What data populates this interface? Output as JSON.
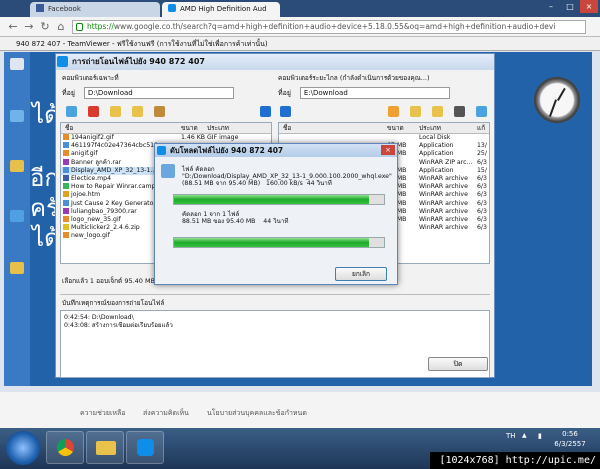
{
  "browser": {
    "tabs": [
      {
        "label": "Facebook"
      },
      {
        "label": "AMD High Definition Aud"
      }
    ],
    "url_scheme": "https://",
    "url_rest": "www.google.co.th/search?q=amd+high+definition+audio+device+5.18.0.55&oq=amd+high+definition+audio+devi"
  },
  "teamviewer": {
    "title": "940 872 407 - TeamViewer - ฟรีใช้งานฟรี (การใช้งานที่ไม่ใช่เพื่อการค้าเท่านั้น)"
  },
  "remote_desktop": {
    "left_chars": [
      "ได้",
      "อีก",
      "ครั",
      "ได้"
    ]
  },
  "file_transfer": {
    "title": "การถ่ายโอนไฟล์ไปยัง 940 872 407",
    "local_heading": "คอมพิวเตอร์เฉพาะที่",
    "remote_heading": "คอมพิวเตอร์ระยะไกล (กำลังดำเนินการด้วยของคุณ...)",
    "loc_label": "ที่อยู่",
    "local_path": "D:\\Download",
    "remote_path": "E:\\Download",
    "columns": {
      "name": "ชื่อ",
      "size": "ขนาด",
      "type": "ประเภท",
      "modified": "แก้"
    },
    "local_files": [
      {
        "name": "194anigif2.gif",
        "size": "1.46 KB",
        "type": "GIF image",
        "color": "#e88b2b"
      },
      {
        "name": "461197f4c02e47364cbc519...",
        "size": "",
        "type": "",
        "color": "#4c8fd6"
      },
      {
        "name": "anigif.gif",
        "size": "",
        "type": "",
        "color": "#e88b2b"
      },
      {
        "name": "Banner ลูกค้า.rar",
        "size": "",
        "type": "",
        "color": "#9b3ab5"
      },
      {
        "name": "Display_AMD_XP_32_13-1...",
        "size": "",
        "type": "",
        "color": "#4c8fd6"
      },
      {
        "name": "Electice.mp4",
        "size": "",
        "type": "",
        "color": "#3a5fa8"
      },
      {
        "name": "How to Repair Winrar.campr...",
        "size": "",
        "type": "",
        "color": "#3ab55a"
      },
      {
        "name": "jojoe.htm",
        "size": "",
        "type": "",
        "color": "#e0a020"
      },
      {
        "name": "Just Cause 2 Key Generato...",
        "size": "",
        "type": "",
        "color": "#4c8fd6"
      },
      {
        "name": "luliangbao_79300.rar",
        "size": "",
        "type": "",
        "color": "#9b3ab5"
      },
      {
        "name": "logo_new_35.gif",
        "size": "",
        "type": "",
        "color": "#e88b2b"
      },
      {
        "name": "Multiclicker2_2.4.6.zip",
        "size": "",
        "type": "",
        "color": "#e0c020"
      },
      {
        "name": "new_logo.gif",
        "size": "",
        "type": "",
        "color": "#e88b2b"
      }
    ],
    "remote_files": [
      {
        "size": "",
        "type": "Local Disk",
        "date": ""
      },
      {
        "size": "67 MB",
        "type": "Application",
        "date": "13/"
      },
      {
        "size": "85 MB",
        "type": "Application",
        "date": "25/"
      },
      {
        "size": "",
        "type": "WinRAR ZIP arc...",
        "date": "6/3"
      },
      {
        "size": "88 MB",
        "type": "Application",
        "date": "15/"
      },
      {
        "size": "77 MB",
        "type": "WinRAR archive",
        "date": "6/3"
      },
      {
        "size": "72 MB",
        "type": "WinRAR archive",
        "date": "6/3"
      },
      {
        "size": "48 MB",
        "type": "WinRAR archive",
        "date": "6/3"
      },
      {
        "size": "83 MB",
        "type": "WinRAR archive",
        "date": "6/3"
      },
      {
        "size": "39 MB",
        "type": "WinRAR archive",
        "date": "6/3"
      },
      {
        "size": "53 MB",
        "type": "WinRAR archive",
        "date": "6/3"
      },
      {
        "size": "",
        "type": "WinRAR archive",
        "date": "6/3"
      },
      {
        "size": "",
        "type": "",
        "date": ""
      }
    ],
    "status_text": "เลือกแล้ว 1 ออบเจ็กต์  95.40 MB",
    "log_heading": "บันทึกเหตุการณ์ของการถ่ายโอนไฟล์",
    "log_lines": [
      "0:42:54: D:\\Download\\",
      "0:43:08: สร้างการเชื่อมต่อเรียบร้อยแล้ว"
    ],
    "close_label": "ปิด"
  },
  "dialog": {
    "title": "ดับโหลดไฟล์ไปยัง 940 872 407",
    "file_label": "ไฟล์ คัดลอก",
    "file_path": "\"D:/Download/Display_AMD_XP_32_13-1_9.000.100.2000_whql.exe\"",
    "file_stats": "(88.51 MB จาก 95.40 MB)   160.00 kB/s  44 วินาที",
    "total_label": "คัดลอก 1 จาก 1 ไฟล์",
    "total_stats": "88.51 MB ของ 95.40 MB    44 วินาที",
    "file_progress": 0.93,
    "total_progress": 0.93,
    "cancel_label": "ยกเลิก"
  },
  "footer": {
    "links": [
      "ความช่วยเหลือ",
      "ส่งความคิดเห็น",
      "นโยบายส่วนบุคคลและข้อกำหนด"
    ]
  },
  "taskbar": {
    "lang": "TH",
    "time": "0:56",
    "date": "6/3/2557"
  },
  "watermark": "[1024x768] http://upic.me/"
}
